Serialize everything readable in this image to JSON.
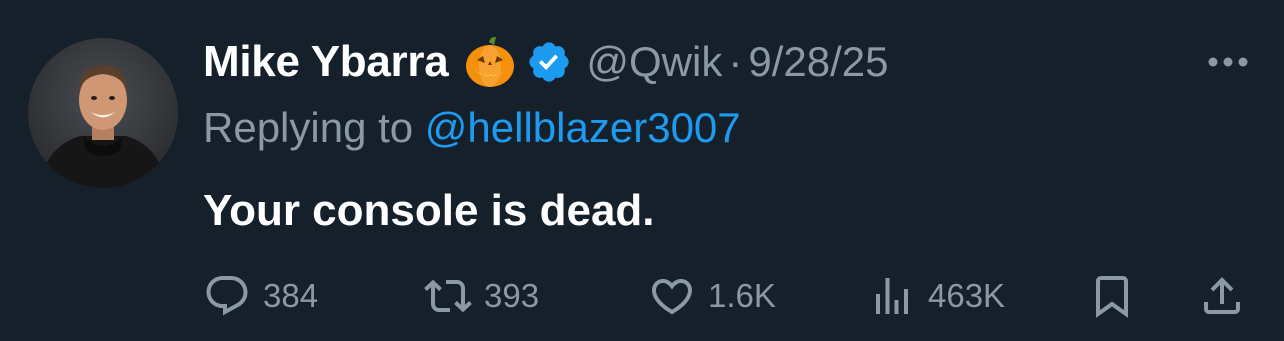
{
  "author": {
    "display_name": "Mike Ybarra",
    "emoji": "pumpkin-emoji",
    "verified": true,
    "handle": "@Qwik",
    "separator": "·",
    "date": "9/28/25"
  },
  "reply": {
    "prefix": "Replying to ",
    "mention": "@hellblazer3007"
  },
  "text": "Your console is dead.",
  "actions": {
    "replies": "384",
    "retweets": "393",
    "likes": "1.6K",
    "views": "463K"
  },
  "icons": {
    "reply": "reply-icon",
    "retweet": "retweet-icon",
    "like": "heart-icon",
    "views": "views-icon",
    "bookmark": "bookmark-icon",
    "share": "share-icon",
    "more": "more-icon"
  },
  "colors": {
    "background": "#15202b",
    "primary_text": "#ffffff",
    "secondary_text": "#8b98a5",
    "accent": "#1d9bf0"
  }
}
